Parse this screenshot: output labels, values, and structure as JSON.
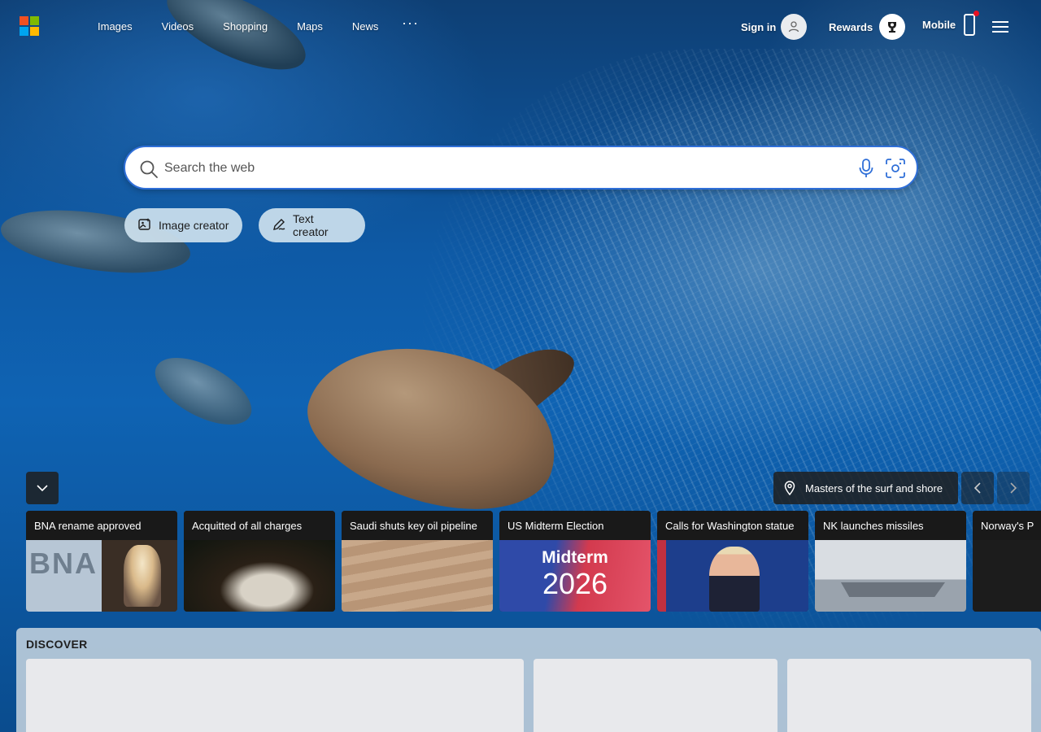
{
  "nav": {
    "links": [
      "Images",
      "Videos",
      "Shopping",
      "Maps",
      "News"
    ],
    "more": "···",
    "signin_label": "Sign in",
    "rewards_label": "Rewards",
    "mobile_label": "Mobile"
  },
  "search": {
    "placeholder": "Search the web"
  },
  "pills": {
    "image_creator": "Image creator",
    "text_creator": "Text creator"
  },
  "location_chip": "Masters of the surf and shore",
  "news": [
    {
      "title": "BNA rename approved",
      "thumb_text": "BNA"
    },
    {
      "title": "Acquitted of all charges"
    },
    {
      "title": "Saudi shuts key oil pipeline"
    },
    {
      "title": "US Midterm Election",
      "thumb_line1": "Midterm",
      "thumb_line2": "2026"
    },
    {
      "title": "Calls for Washington statue"
    },
    {
      "title": "NK launches missiles"
    },
    {
      "title": "Norway's P"
    }
  ],
  "discover": {
    "title": "DISCOVER"
  },
  "colors": {
    "accent_blue": "#2f6fd8",
    "ms_red": "#f25022",
    "ms_green": "#7fba00",
    "ms_blue": "#00a4ef",
    "ms_yellow": "#ffb900",
    "notification_red": "#e81123"
  }
}
